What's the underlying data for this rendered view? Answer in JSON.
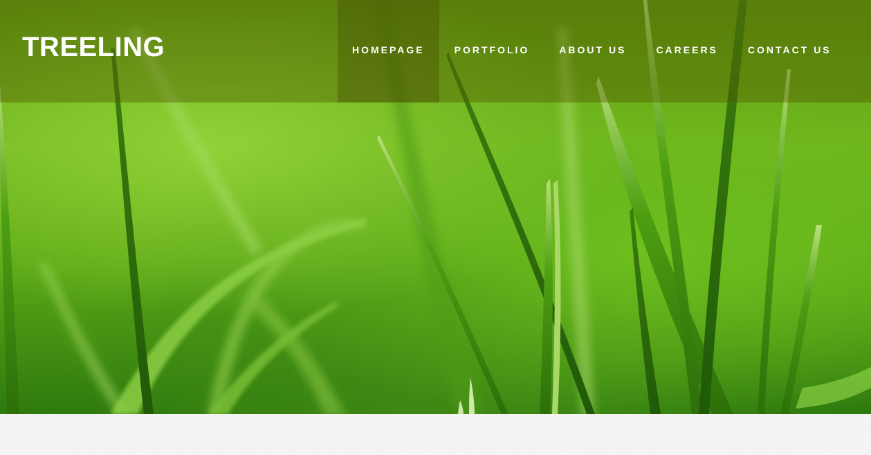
{
  "brand": {
    "name": "TREELING"
  },
  "nav": {
    "items": [
      {
        "label": "HOMEPAGE",
        "active": true
      },
      {
        "label": "PORTFOLIO",
        "active": false
      },
      {
        "label": "ABOUT US",
        "active": false
      },
      {
        "label": "CAREERS",
        "active": false
      },
      {
        "label": "CONTACT US",
        "active": false
      }
    ]
  },
  "colors": {
    "header_overlay": "#505a00",
    "text": "#ffffff",
    "grass": "#6fb41c",
    "footer": "#f5f5f5"
  },
  "hero": {
    "image": "grass-blades-closeup"
  }
}
